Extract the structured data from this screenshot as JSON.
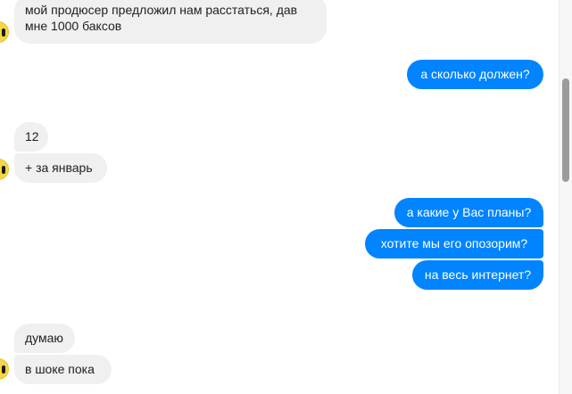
{
  "messages": [
    {
      "id": "m1",
      "sender": "incoming",
      "text": "мой продюсер предложил нам расстаться, дав мне 1000 баксов"
    },
    {
      "id": "m2",
      "sender": "outgoing",
      "text": "а сколько должен?"
    },
    {
      "id": "m3",
      "sender": "incoming",
      "text": "12"
    },
    {
      "id": "m4",
      "sender": "incoming",
      "text": "+ за январь"
    },
    {
      "id": "m5",
      "sender": "outgoing",
      "text": "а какие у Вас планы?"
    },
    {
      "id": "m6",
      "sender": "outgoing",
      "text": "хотите мы его опозорим?"
    },
    {
      "id": "m7",
      "sender": "outgoing",
      "text": "на весь интернет?"
    },
    {
      "id": "m8",
      "sender": "incoming",
      "text": "думаю"
    },
    {
      "id": "m9",
      "sender": "incoming",
      "text": "в шоке пока"
    }
  ],
  "colors": {
    "outgoing_bubble": "#0084ff",
    "incoming_bubble": "#f1f0f0",
    "avatar": "#f6d743"
  },
  "icons": {
    "avatar": "contact-avatar-icon"
  }
}
